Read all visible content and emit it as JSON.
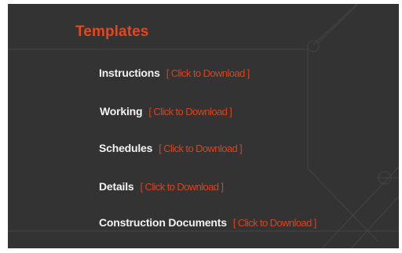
{
  "section": {
    "title": "Templates"
  },
  "downloads": [
    {
      "label": "Instructions",
      "link": "[ Click to Download ]"
    },
    {
      "label": "Working",
      "link": "[ Click to Download ]"
    },
    {
      "label": "Schedules",
      "link": "[ Click to Download ]"
    },
    {
      "label": "Details",
      "link": "[ Click to Download ]"
    },
    {
      "label": "Construction Documents",
      "link": "[ Click to Download ]"
    }
  ],
  "colors": {
    "panel_background": "#333333",
    "title": "#e8451a",
    "label": "#f2f2f2",
    "link": "#d9431c"
  }
}
